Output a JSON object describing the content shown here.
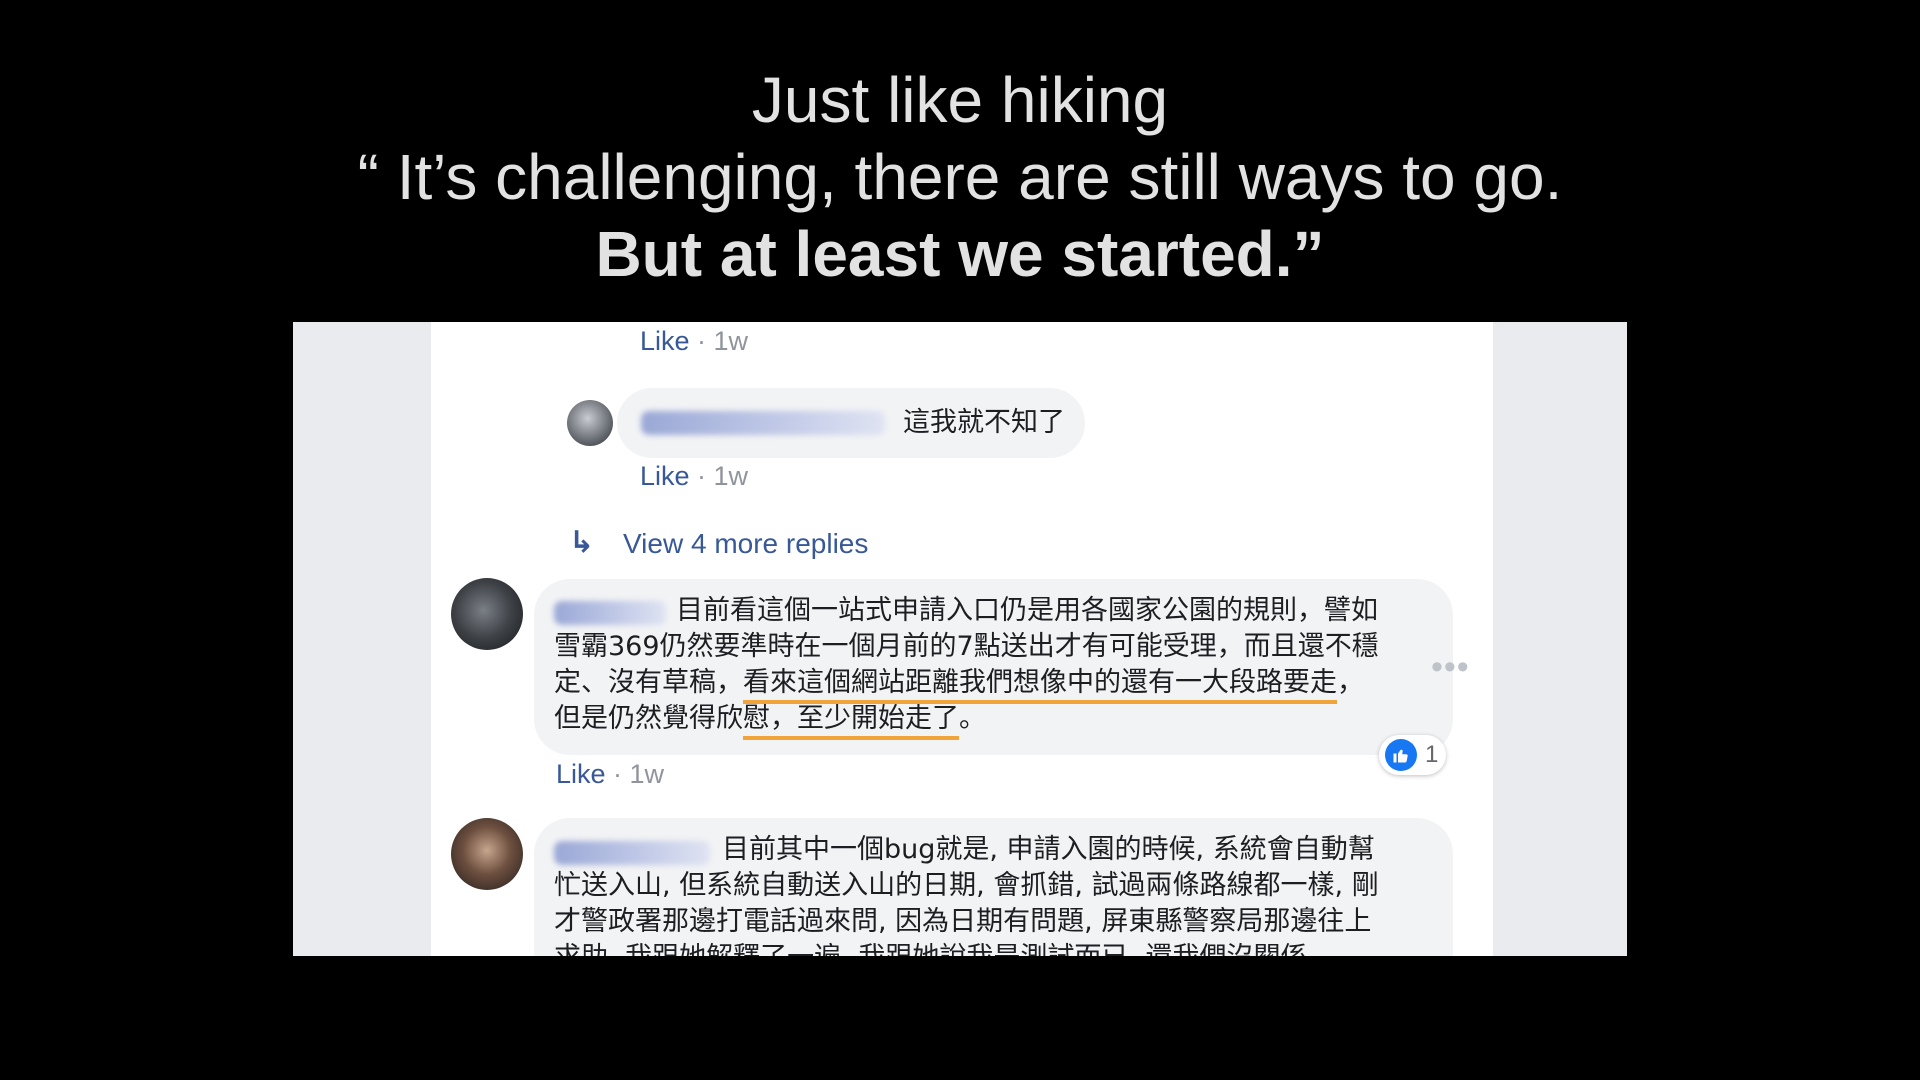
{
  "quote": {
    "line1": "Just like hiking",
    "line2": "“ It’s challenging, there are still ways to go.",
    "line3": "But at least we started.”"
  },
  "feed": {
    "top_meta": {
      "like": "Like",
      "sep": " · ",
      "time": "1w"
    },
    "reply1": {
      "text": "這我就不知了",
      "meta": {
        "like": "Like",
        "sep": " · ",
        "time": "1w"
      }
    },
    "view_more": {
      "arrow": "↳",
      "label": "View 4 more replies"
    },
    "comment1": {
      "l1": "目前看這個一站式申請入口仍是用各國家公園的規則，譬如",
      "l2": "雪霸369仍然要準時在一個月前的7點送出才有可能受理，而且還不穩",
      "l3_a": "定、沒有草稿，",
      "l3_b": "看來這個網站距離我們想像中的還有一大段路要走",
      "l3_c": "，",
      "l4_a": "但是仍然覺得欣",
      "l4_b": "慰，至少開始走了",
      "l4_c": "。",
      "reaction_count": "1",
      "meta": {
        "like": "Like",
        "sep": " · ",
        "time": "1w"
      },
      "more": "•••"
    },
    "comment2": {
      "l1": "目前其中一個bug就是, 申請入園的時候, 系統會自動幫",
      "l2": "忙送入山, 但系統自動送入山的日期, 會抓錯, 試過兩條路線都一樣, 剛",
      "l3": "才警政署那邊打電話過來問, 因為日期有問題, 屏東縣警察局那邊往上",
      "l4": "求助. 我跟她解釋了一遍, 我跟她說我是測試而已, 還我們沒關係"
    }
  },
  "colors": {
    "link": "#385898",
    "highlight": "#f0a43a",
    "bubble": "#f2f3f5"
  }
}
